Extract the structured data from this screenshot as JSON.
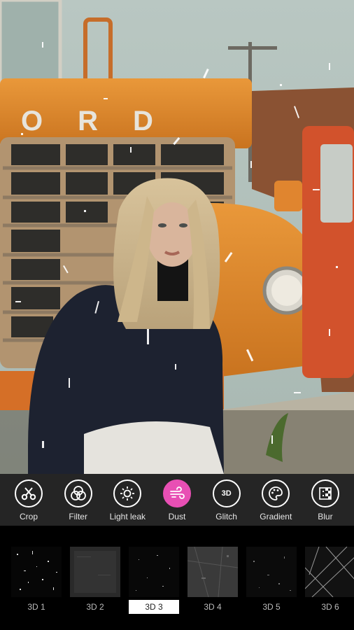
{
  "photo": {
    "truck_letters": "ORD"
  },
  "tools": [
    {
      "label": "Crop",
      "icon": "scissors-icon",
      "active": false
    },
    {
      "label": "Filter",
      "icon": "filter-circles-icon",
      "active": false
    },
    {
      "label": "Light leak",
      "icon": "sun-icon",
      "active": false
    },
    {
      "label": "Dust",
      "icon": "wind-icon",
      "active": true
    },
    {
      "label": "Glitch",
      "icon": "3d-icon",
      "glyph": "3D",
      "active": false
    },
    {
      "label": "Gradient",
      "icon": "palette-icon",
      "active": false
    },
    {
      "label": "Blur",
      "icon": "blur-icon",
      "active": false
    }
  ],
  "presets": [
    {
      "label": "3D 1",
      "selected": false
    },
    {
      "label": "3D 2",
      "selected": false
    },
    {
      "label": "3D 3",
      "selected": true
    },
    {
      "label": "3D 4",
      "selected": false
    },
    {
      "label": "3D 5",
      "selected": false
    },
    {
      "label": "3D 6",
      "selected": false
    }
  ],
  "colors": {
    "accent": "#e84fb4",
    "toolbar_bg": "#252525",
    "truck_orange": "#e08a2e"
  }
}
